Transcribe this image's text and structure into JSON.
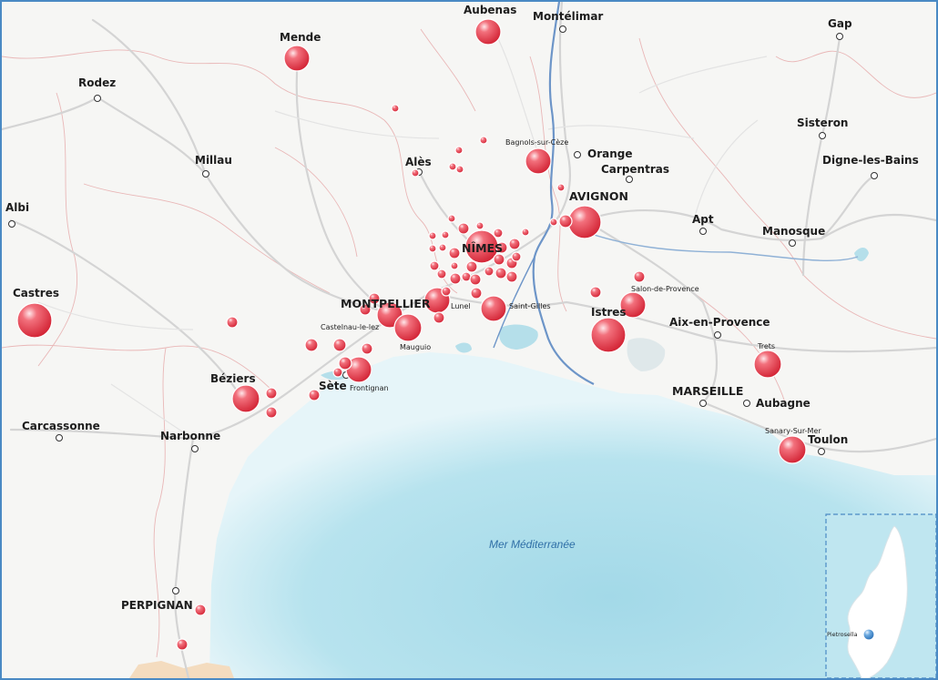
{
  "map": {
    "sea_label": "Mer Méditerranée",
    "colors": {
      "sea": "#a9dcea",
      "land": "#f6f6f4",
      "marker": "#e23a4a",
      "inset_marker": "#3b86c8",
      "river": "#6d95c8",
      "road": "#d6d6d6",
      "border": "#e9b7b7",
      "frame": "#4a8ac4"
    },
    "cities": [
      {
        "id": "aubenas",
        "label": "Aubenas"
      },
      {
        "id": "montelimar",
        "label": "Montélimar"
      },
      {
        "id": "gap",
        "label": "Gap"
      },
      {
        "id": "mende",
        "label": "Mende"
      },
      {
        "id": "rodez",
        "label": "Rodez"
      },
      {
        "id": "sisteron",
        "label": "Sisteron"
      },
      {
        "id": "bagnols",
        "label": "Bagnols-sur-Cèze"
      },
      {
        "id": "orange",
        "label": "Orange"
      },
      {
        "id": "millau",
        "label": "Millau"
      },
      {
        "id": "ales",
        "label": "Alès"
      },
      {
        "id": "carpentras",
        "label": "Carpentras"
      },
      {
        "id": "digne",
        "label": "Digne-les-Bains"
      },
      {
        "id": "avignon",
        "label": "AVIGNON"
      },
      {
        "id": "albi",
        "label": "Albi"
      },
      {
        "id": "apt",
        "label": "Apt"
      },
      {
        "id": "manosque",
        "label": "Manosque"
      },
      {
        "id": "nimes",
        "label": "NÎMES"
      },
      {
        "id": "salon",
        "label": "Salon-de-Provence"
      },
      {
        "id": "castres",
        "label": "Castres"
      },
      {
        "id": "montpellier",
        "label": "MONTPELLIER"
      },
      {
        "id": "lunel",
        "label": "Lunel"
      },
      {
        "id": "saintgilles",
        "label": "Saint-Gilles"
      },
      {
        "id": "istres",
        "label": "Istres"
      },
      {
        "id": "aix",
        "label": "Aix-en-Provence"
      },
      {
        "id": "castelnau",
        "label": "Castelnau-le-lez"
      },
      {
        "id": "mauguio",
        "label": "Mauguio"
      },
      {
        "id": "trets",
        "label": "Trets"
      },
      {
        "id": "beziers",
        "label": "Béziers"
      },
      {
        "id": "sete",
        "label": "Sète"
      },
      {
        "id": "frontignan",
        "label": "Frontignan"
      },
      {
        "id": "marseille",
        "label": "MARSEILLE"
      },
      {
        "id": "aubagne",
        "label": "Aubagne"
      },
      {
        "id": "carcassonne",
        "label": "Carcassonne"
      },
      {
        "id": "sanary",
        "label": "Sanary-Sur-Mer"
      },
      {
        "id": "narbonne",
        "label": "Narbonne"
      },
      {
        "id": "toulon",
        "label": "Toulon"
      },
      {
        "id": "perpignan",
        "label": "PERPIGNAN"
      }
    ],
    "inset": {
      "label": "Pietrosella"
    }
  }
}
